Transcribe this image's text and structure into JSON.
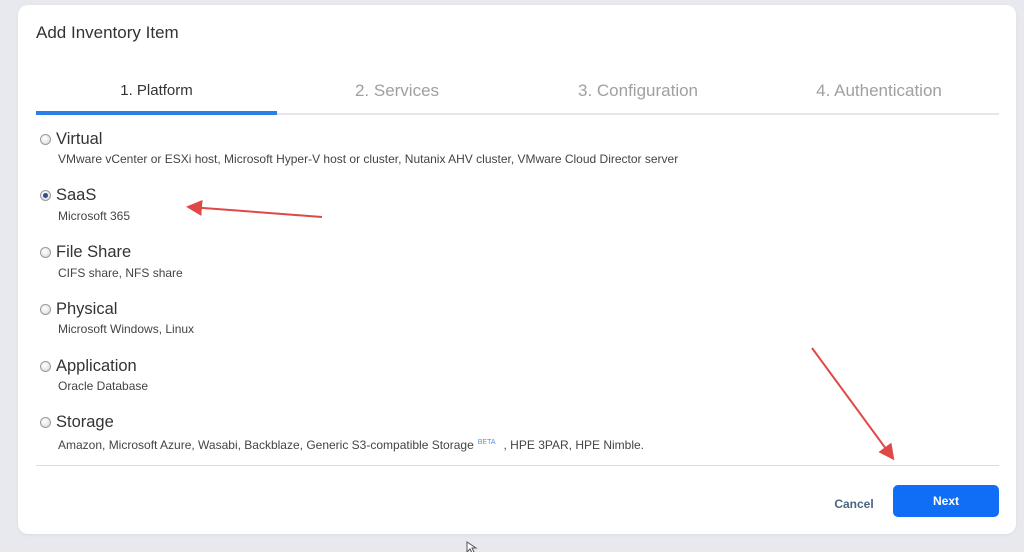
{
  "dialog": {
    "title": "Add Inventory Item"
  },
  "wizard": {
    "steps": [
      {
        "label": "1. Platform",
        "active": true
      },
      {
        "label": "2. Services",
        "active": false
      },
      {
        "label": "3. Configuration",
        "active": false
      },
      {
        "label": "4. Authentication",
        "active": false
      }
    ]
  },
  "platforms": {
    "selected": "SaaS",
    "options": [
      {
        "label": "Virtual",
        "description": "VMware vCenter or ESXi host, Microsoft Hyper-V host or cluster, Nutanix AHV cluster, VMware Cloud Director server",
        "checked": false
      },
      {
        "label": "SaaS",
        "description": "Microsoft 365",
        "checked": true
      },
      {
        "label": "File Share",
        "description": "CIFS share, NFS share",
        "checked": false
      },
      {
        "label": "Physical",
        "description": "Microsoft Windows, Linux",
        "checked": false
      },
      {
        "label": "Application",
        "description": "Oracle Database",
        "checked": false
      },
      {
        "label": "Storage",
        "description": "Amazon, Microsoft Azure, Wasabi, Backblaze, Generic S3-compatible Storage",
        "badge": "BETA",
        "description_suffix": ", HPE 3PAR, HPE Nimble.",
        "checked": false
      }
    ]
  },
  "footer": {
    "cancel_label": "Cancel",
    "next_label": "Next"
  },
  "colors": {
    "accent": "#2d7fe8",
    "primary_button": "#0f6ef5",
    "annotation_arrow": "#e04848",
    "background": "#e7e9ef"
  }
}
